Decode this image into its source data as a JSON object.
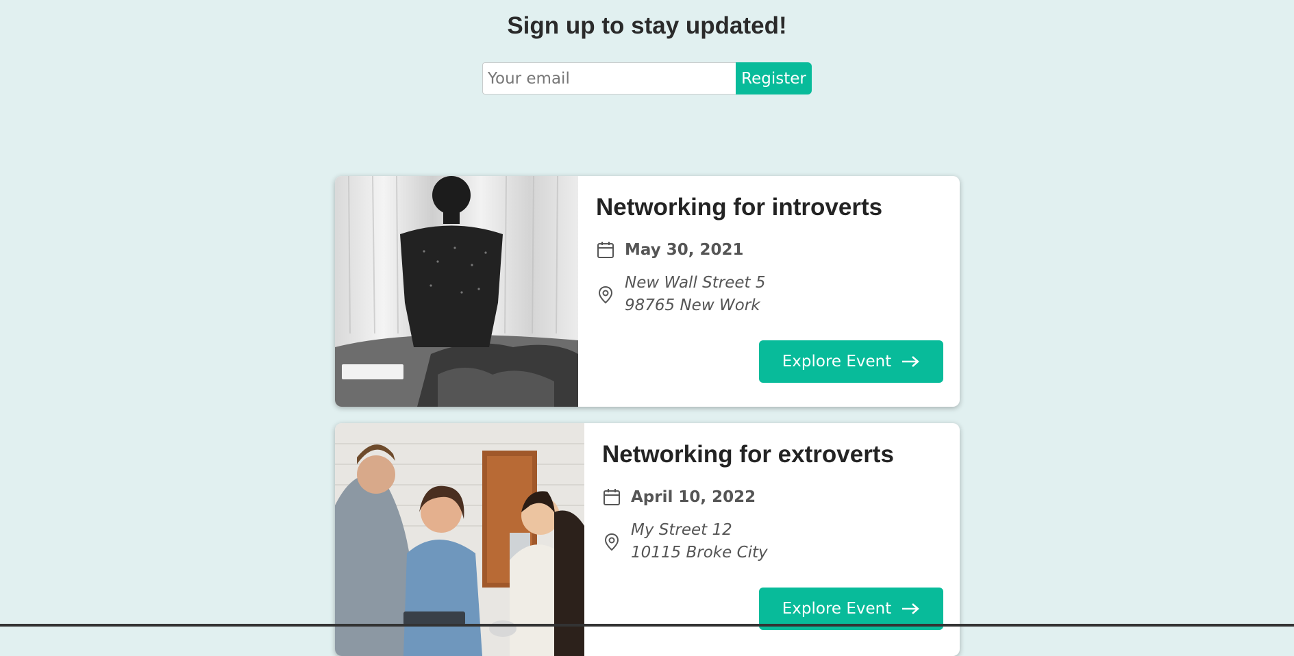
{
  "signup": {
    "title": "Sign up to stay updated!",
    "email_placeholder": "Your email",
    "register_label": "Register"
  },
  "events": [
    {
      "title": "Networking for introverts",
      "date": "May 30, 2021",
      "address_line1": "New Wall Street 5",
      "address_line2": "98765 New Work",
      "button_label": "Explore Event",
      "image_desc": "person sitting on bed"
    },
    {
      "title": "Networking for extroverts",
      "date": "April 10, 2022",
      "address_line1": "My Street 12",
      "address_line2": "10115 Broke City",
      "button_label": "Explore Event",
      "image_desc": "group of people talking"
    }
  ],
  "colors": {
    "background": "#e1f0f0",
    "accent": "#08bb9a",
    "card": "#ffffff"
  }
}
